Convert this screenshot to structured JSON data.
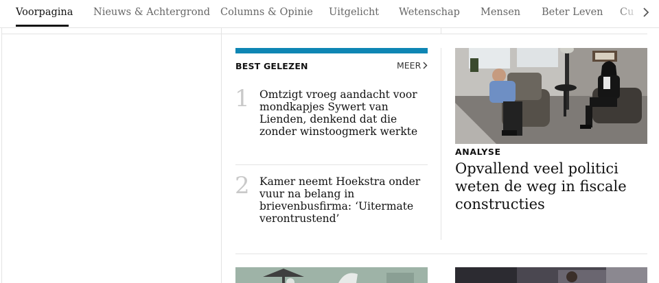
{
  "nav": {
    "items": [
      {
        "label": "Voorpagina",
        "active": true
      },
      {
        "label": "Nieuws & Achtergrond"
      },
      {
        "label": "Columns & Opinie"
      },
      {
        "label": "Uitgelicht"
      },
      {
        "label": "Wetenschap"
      },
      {
        "label": "Mensen"
      },
      {
        "label": "Beter Leven"
      },
      {
        "label": "Cu"
      }
    ],
    "chevron_icon": "chevron-right-icon"
  },
  "best_gelezen": {
    "title": "BEST GELEZEN",
    "more_label": "MEER",
    "accent_color": "#0e86b4",
    "items": [
      {
        "rank": "1",
        "headline": "Omtzigt vroeg aandacht voor mondkapjes Sywert van Lienden, denkend dat die zonder winstoogmerk werkte"
      },
      {
        "rank": "2",
        "headline": "Kamer neemt Hoekstra onder vuur na belang in brievenbusfirma: ‘Uitermate verontrustend’"
      }
    ]
  },
  "featured": {
    "label": "ANALYSE",
    "headline": "Opvallend veel politici weten de weg in fiscale constructies"
  }
}
